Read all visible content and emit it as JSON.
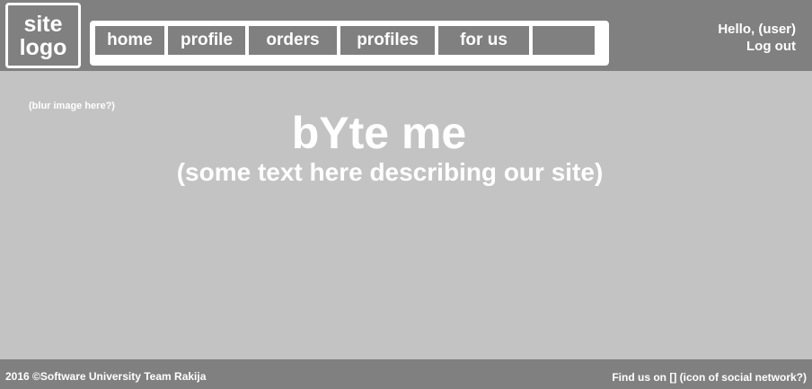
{
  "header": {
    "logo_text": "site\nlogo",
    "nav": [
      {
        "label": "home"
      },
      {
        "label": "profile"
      },
      {
        "label": "orders"
      },
      {
        "label": "profiles"
      },
      {
        "label": "for us"
      },
      {
        "label": ""
      }
    ],
    "user": {
      "greeting": "Hello, (user)",
      "logout": "Log out"
    }
  },
  "main": {
    "blur_note": "(blur image here?)",
    "title": "bYte me",
    "subtitle": "(some text here describing our site)"
  },
  "footer": {
    "copyright": "2016 ©Software University Team Rakija",
    "social": "Find us on [] (icon of social network?)"
  },
  "colors": {
    "header_bg": "#808080",
    "body_bg": "#c3c3c3",
    "text": "#ffffff"
  }
}
